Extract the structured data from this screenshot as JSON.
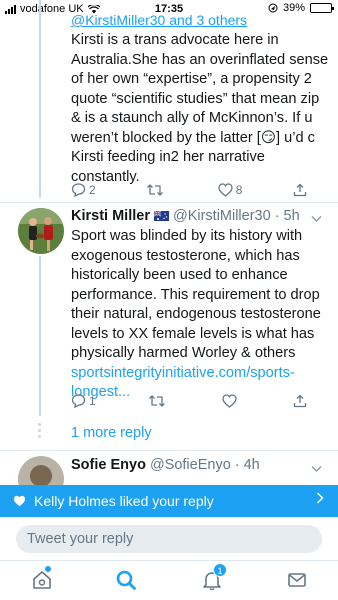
{
  "status_bar": {
    "carrier": "vodafone UK",
    "time": "17:35",
    "battery": "39%",
    "battery_level": 0.39
  },
  "thread_top": {
    "reply_to": "@KirstiMiller30 and 3 others",
    "text": "Kirsti is a trans advocate here in Australia.She has an overinflated sense of her own “expertise”, a propensity 2 quote “scientific studies” that mean zip & is a staunch ally of McKinnon’s. If u weren’t blocked by the latter [😏] u’d c Kirsti feeding in2 her narrative constantly.",
    "reply_count": "2",
    "retweet_count": "",
    "like_count": "8"
  },
  "tweet_kirsti": {
    "name": "Kirsti Miller",
    "handle": "@KirstiMiller30",
    "time": "5h",
    "text": "Sport was blinded by its history with exogenous testosterone, which has historically been used to enhance performance. This requirement to drop their natural, endogenous testosterone levels to XX female levels is what has physically harmed Worley & others",
    "link": "sportsintegrityinitiative.com/sports-longest...",
    "reply_count": "1",
    "retweet_count": "",
    "like_count": ""
  },
  "more_replies": "1 more reply",
  "tweet_sofie": {
    "name": "Sofie Enyo",
    "handle": "@SofieEnyo",
    "time": "4h"
  },
  "toast": {
    "text": "Kelly Holmes liked your reply"
  },
  "compose": {
    "placeholder": "Tweet your reply"
  },
  "tabbar": {
    "notifications_badge": "1"
  }
}
